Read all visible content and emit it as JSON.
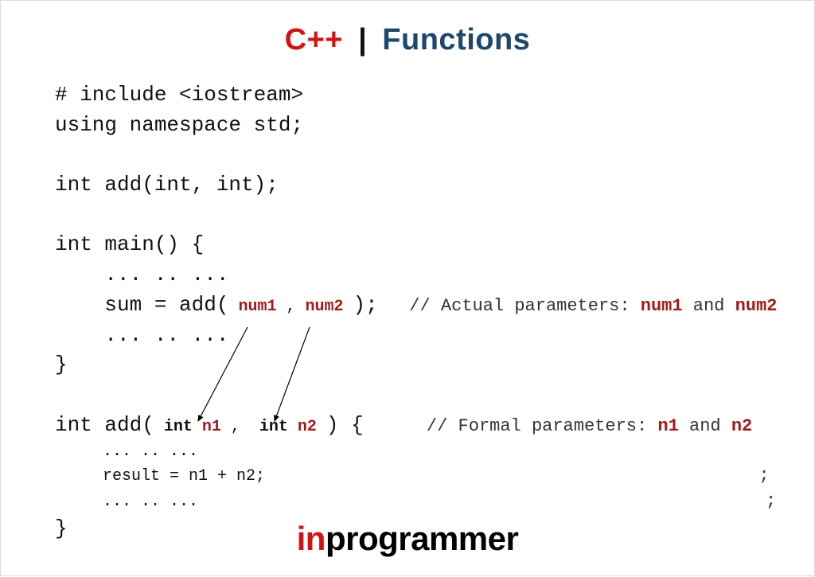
{
  "title": {
    "cpp": "C++",
    "bar": "|",
    "functions": "Functions"
  },
  "code": {
    "l1": "# include <iostream>",
    "l2": "using namespace std;",
    "l3": "int add(int, int);",
    "l4": "int main() {",
    "l5_a": "    ... .. ...",
    "l6_a": "    sum = add(",
    "l6_num1": " num1 ",
    "l6_comma": ",",
    "l6_num2": " num2 ",
    "l6_close": ");",
    "l6_comment_a": "   // Actual parameters: ",
    "l6_comment_num1": "num1",
    "l6_comment_mid": " and ",
    "l6_comment_num2": "num2",
    "l7_a": "    ... .. ...",
    "l8": "}",
    "l9_a": "int add(",
    "l9_int1": " int",
    "l9_n1": " n1 ",
    "l9_comma": ",",
    "l9_int2": "  int",
    "l9_n2": " n2 ",
    "l9_close": ") {",
    "l9_comment_a": "      // Formal parameters: ",
    "l9_comment_n1": "n1",
    "l9_comment_mid": " and ",
    "l9_comment_n2": "n2",
    "l10_a": "     ... .. ...",
    "l11_a": "     result = n1 + n2;",
    "l11_stray": "                                               ;",
    "l12_a": "     ... .. ...",
    "l12_stray": "                                                      ;",
    "l13": "}"
  },
  "footer": {
    "in": "in",
    "rest": "programmer"
  }
}
